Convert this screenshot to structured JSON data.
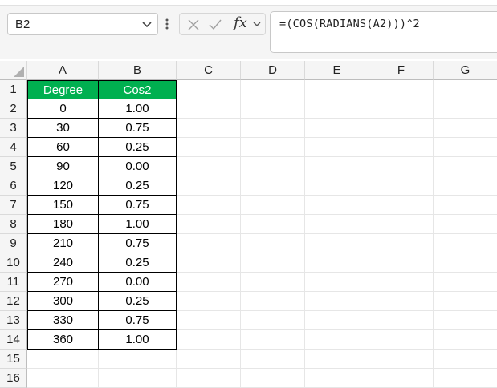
{
  "name_box": {
    "value": "B2"
  },
  "formula_bar": {
    "fx_label": "fx",
    "formula": "=(COS(RADIANS(A2)))^2"
  },
  "columns": [
    "A",
    "B",
    "C",
    "D",
    "E",
    "F",
    "G"
  ],
  "rows": [
    {
      "num": "1",
      "a": "Degree",
      "b": "Cos2"
    },
    {
      "num": "2",
      "a": "0",
      "b": "1.00"
    },
    {
      "num": "3",
      "a": "30",
      "b": "0.75"
    },
    {
      "num": "4",
      "a": "60",
      "b": "0.25"
    },
    {
      "num": "5",
      "a": "90",
      "b": "0.00"
    },
    {
      "num": "6",
      "a": "120",
      "b": "0.25"
    },
    {
      "num": "7",
      "a": "150",
      "b": "0.75"
    },
    {
      "num": "8",
      "a": "180",
      "b": "1.00"
    },
    {
      "num": "9",
      "a": "210",
      "b": "0.75"
    },
    {
      "num": "10",
      "a": "240",
      "b": "0.25"
    },
    {
      "num": "11",
      "a": "270",
      "b": "0.00"
    },
    {
      "num": "12",
      "a": "300",
      "b": "0.25"
    },
    {
      "num": "13",
      "a": "330",
      "b": "0.75"
    },
    {
      "num": "14",
      "a": "360",
      "b": "1.00"
    },
    {
      "num": "15",
      "a": "",
      "b": ""
    },
    {
      "num": "16",
      "a": "",
      "b": ""
    }
  ],
  "colors": {
    "header_fill": "#00b050",
    "header_text": "#ffffff"
  }
}
